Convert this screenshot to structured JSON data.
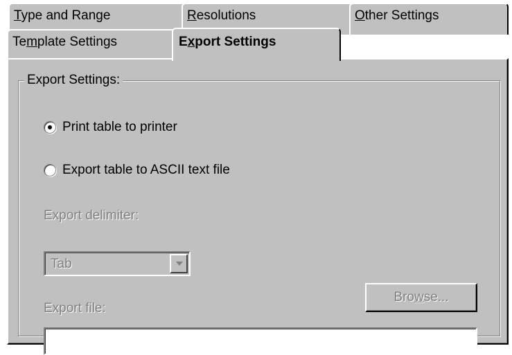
{
  "tabs": {
    "back_row": [
      {
        "pre": "",
        "ul": "T",
        "post": "ype and Range"
      },
      {
        "pre": "",
        "ul": "R",
        "post": "esolutions"
      },
      {
        "pre": "",
        "ul": "O",
        "post": "ther Settings"
      }
    ],
    "front_row": [
      {
        "pre": "Te",
        "ul": "m",
        "post": "plate Settings"
      },
      {
        "pre": "E",
        "ul": "x",
        "post": "port Settings",
        "active": true
      }
    ]
  },
  "group": {
    "legend": "Export Settings:",
    "radio_print": {
      "label": "Print table to printer",
      "checked": true
    },
    "radio_ascii": {
      "label": "Export table to ASCII text file",
      "checked": false
    },
    "delimiter_label": "Export delimiter:",
    "delimiter_value": "Tab",
    "browse": {
      "pre": "Bro",
      "ul": "w",
      "post": "se..."
    },
    "file_label": "Export file:",
    "file_value": ""
  },
  "colors": {
    "face": "#c0c0c0",
    "highlight": "#ffffff",
    "shadow": "#808080",
    "dark_shadow": "#000000",
    "disabled_text": "#808080"
  }
}
